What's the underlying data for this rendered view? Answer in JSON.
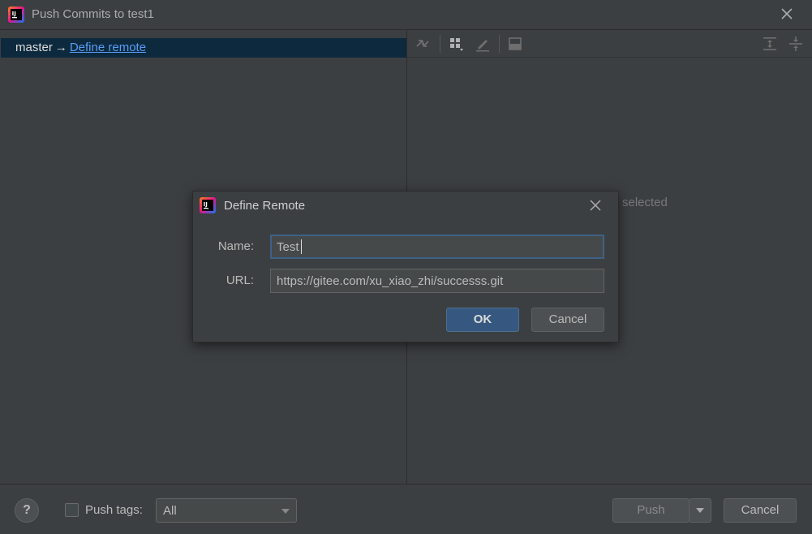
{
  "window": {
    "title": "Push Commits to test1"
  },
  "left_pane": {
    "branch": "master",
    "arrow": "→",
    "define_remote_link": "Define remote"
  },
  "right_pane": {
    "toolbar_icons": [
      "compare-arrows-icon",
      "group-by-icon",
      "edit-icon",
      "preview-icon",
      "expand-all-icon",
      "collapse-all-icon"
    ],
    "empty_text_visible": "selected"
  },
  "bottom_bar": {
    "help_label": "?",
    "push_tags_label": "Push tags:",
    "push_tags_checked": false,
    "tags_select_value": "All",
    "push_label": "Push",
    "cancel_label": "Cancel"
  },
  "dialog": {
    "title": "Define Remote",
    "name_label": "Name:",
    "name_value": "Test",
    "url_label": "URL:",
    "url_value": "https://gitee.com/xu_xiao_zhi/successs.git",
    "ok_label": "OK",
    "cancel_label": "Cancel"
  },
  "colors": {
    "background": "#3c3f41",
    "selected_row": "#0d293e",
    "link": "#589df6",
    "ok_button": "#365880",
    "focus_border": "#3d6185"
  }
}
